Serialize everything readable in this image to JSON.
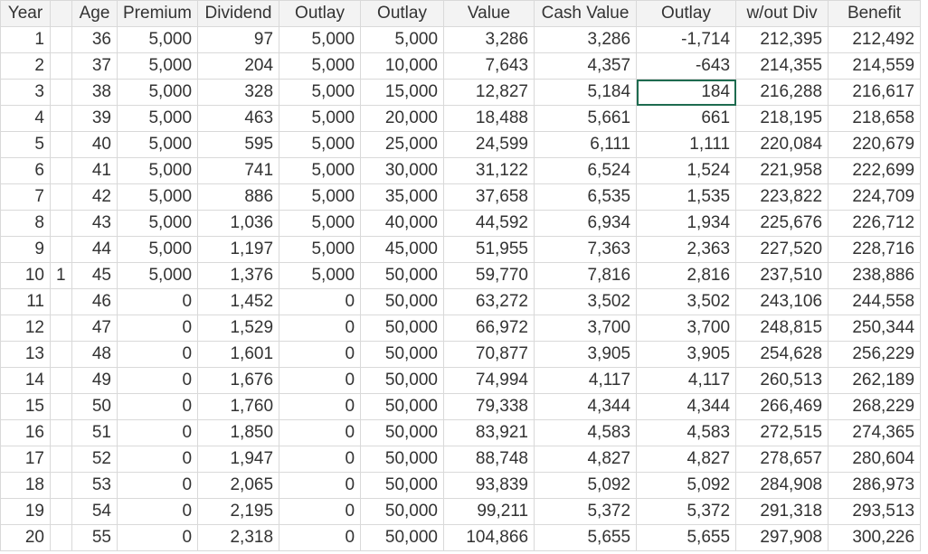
{
  "headers": [
    "Year",
    "",
    "Age",
    "Premium",
    "Dividend",
    "Outlay",
    "Outlay",
    "Value",
    "Cash Value",
    "Outlay",
    "w/out Div",
    "Benefit"
  ],
  "selected_cell": {
    "row": 2,
    "col": 9
  },
  "accent_color": "#1e6b4f",
  "rows": [
    [
      "1",
      "",
      "36",
      "5,000",
      "97",
      "5,000",
      "5,000",
      "3,286",
      "3,286",
      "-1,714",
      "212,395",
      "212,492"
    ],
    [
      "2",
      "",
      "37",
      "5,000",
      "204",
      "5,000",
      "10,000",
      "7,643",
      "4,357",
      "-643",
      "214,355",
      "214,559"
    ],
    [
      "3",
      "",
      "38",
      "5,000",
      "328",
      "5,000",
      "15,000",
      "12,827",
      "5,184",
      "184",
      "216,288",
      "216,617"
    ],
    [
      "4",
      "",
      "39",
      "5,000",
      "463",
      "5,000",
      "20,000",
      "18,488",
      "5,661",
      "661",
      "218,195",
      "218,658"
    ],
    [
      "5",
      "",
      "40",
      "5,000",
      "595",
      "5,000",
      "25,000",
      "24,599",
      "6,111",
      "1,111",
      "220,084",
      "220,679"
    ],
    [
      "6",
      "",
      "41",
      "5,000",
      "741",
      "5,000",
      "30,000",
      "31,122",
      "6,524",
      "1,524",
      "221,958",
      "222,699"
    ],
    [
      "7",
      "",
      "42",
      "5,000",
      "886",
      "5,000",
      "35,000",
      "37,658",
      "6,535",
      "1,535",
      "223,822",
      "224,709"
    ],
    [
      "8",
      "",
      "43",
      "5,000",
      "1,036",
      "5,000",
      "40,000",
      "44,592",
      "6,934",
      "1,934",
      "225,676",
      "226,712"
    ],
    [
      "9",
      "",
      "44",
      "5,000",
      "1,197",
      "5,000",
      "45,000",
      "51,955",
      "7,363",
      "2,363",
      "227,520",
      "228,716"
    ],
    [
      "10",
      "1",
      "45",
      "5,000",
      "1,376",
      "5,000",
      "50,000",
      "59,770",
      "7,816",
      "2,816",
      "237,510",
      "238,886"
    ],
    [
      "11",
      "",
      "46",
      "0",
      "1,452",
      "0",
      "50,000",
      "63,272",
      "3,502",
      "3,502",
      "243,106",
      "244,558"
    ],
    [
      "12",
      "",
      "47",
      "0",
      "1,529",
      "0",
      "50,000",
      "66,972",
      "3,700",
      "3,700",
      "248,815",
      "250,344"
    ],
    [
      "13",
      "",
      "48",
      "0",
      "1,601",
      "0",
      "50,000",
      "70,877",
      "3,905",
      "3,905",
      "254,628",
      "256,229"
    ],
    [
      "14",
      "",
      "49",
      "0",
      "1,676",
      "0",
      "50,000",
      "74,994",
      "4,117",
      "4,117",
      "260,513",
      "262,189"
    ],
    [
      "15",
      "",
      "50",
      "0",
      "1,760",
      "0",
      "50,000",
      "79,338",
      "4,344",
      "4,344",
      "266,469",
      "268,229"
    ],
    [
      "16",
      "",
      "51",
      "0",
      "1,850",
      "0",
      "50,000",
      "83,921",
      "4,583",
      "4,583",
      "272,515",
      "274,365"
    ],
    [
      "17",
      "",
      "52",
      "0",
      "1,947",
      "0",
      "50,000",
      "88,748",
      "4,827",
      "4,827",
      "278,657",
      "280,604"
    ],
    [
      "18",
      "",
      "53",
      "0",
      "2,065",
      "0",
      "50,000",
      "93,839",
      "5,092",
      "5,092",
      "284,908",
      "286,973"
    ],
    [
      "19",
      "",
      "54",
      "0",
      "2,195",
      "0",
      "50,000",
      "99,211",
      "5,372",
      "5,372",
      "291,318",
      "293,513"
    ],
    [
      "20",
      "",
      "55",
      "0",
      "2,318",
      "0",
      "50,000",
      "104,866",
      "5,655",
      "5,655",
      "297,908",
      "300,226"
    ]
  ]
}
